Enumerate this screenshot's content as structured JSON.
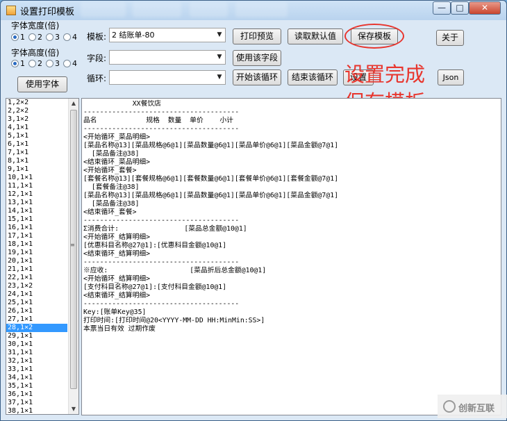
{
  "window": {
    "title": "设置打印模板",
    "controls": {
      "minimize": "—",
      "maximize": "□",
      "close": "✕"
    }
  },
  "left_panel": {
    "font_width_label": "字体宽度(倍)",
    "font_height_label": "字体高度(倍)",
    "width_options": [
      "1",
      "2",
      "3",
      "4"
    ],
    "width_selected": "1",
    "height_options": [
      "1",
      "2",
      "3",
      "4"
    ],
    "height_selected": "1",
    "use_font_button": "使用字体"
  },
  "fields": {
    "template_label": "模板:",
    "template_value": "2 结账单-80",
    "field_label": "字段:",
    "field_value": "",
    "loop_label": "循环:",
    "loop_value": ""
  },
  "buttons": {
    "print_preview": "打印预览",
    "read_default": "读取默认值",
    "save_template": "保存模板",
    "about": "关于",
    "use_field": "使用该字段",
    "start_loop": "开始该循环",
    "end_loop": "结束该循环",
    "set": "设置",
    "json": "Json"
  },
  "annotation": {
    "line1": "设置完成",
    "line2": "保存模板",
    "color": "#e8352d"
  },
  "list_items": [
    "1,2×2",
    "2,2×2",
    "3,1×2",
    "4,1×1",
    "5,1×1",
    "6,1×1",
    "7,1×1",
    "8,1×1",
    "9,1×1",
    "10,1×1",
    "11,1×1",
    "12,1×1",
    "13,1×1",
    "14,1×1",
    "15,1×1",
    "16,1×1",
    "17,1×1",
    "18,1×1",
    "19,1×1",
    "20,1×1",
    "21,1×1",
    "22,1×1",
    "23,1×2",
    "24,1×1",
    "25,1×1",
    "26,1×1",
    "27,1×1",
    "28,1×2",
    "29,1×1",
    "30,1×1",
    "31,1×1",
    "32,1×1",
    "33,1×1",
    "34,1×1",
    "35,1×1",
    "36,1×1",
    "37,1×1",
    "38,1×1"
  ],
  "list_selected_index": 27,
  "editor_lines": [
    "            XX餐饮店",
    "--------------------------------------",
    "品名            规格  数量  单价    小计",
    "--------------------------------------",
    "<开始循环_菜品明细>",
    "[菜品名称@13][菜品规格@6@1][菜品数量@6@1][菜品单价@6@1][菜品金额@7@1]",
    "  [菜品备注@38]",
    "<结束循环_菜品明细>",
    "<开始循环_套餐>",
    "[套餐名称@13][套餐规格@6@1][套餐数量@6@1][套餐单价@6@1][套餐金额@7@1]",
    "  [套餐备注@38]",
    "[菜品名称@13][菜品规格@6@1][菜品数量@6@1][菜品单价@6@1][菜品金额@7@1]",
    "  [菜品备注@38]",
    "<结束循环_套餐>",
    "--------------------------------------",
    "Σ消费合计:                [菜品总金额@10@1]",
    "<开始循环_结算明细>",
    "[优惠科目名称@27@1]:[优惠科目金额@10@1]",
    "<结束循环_结算明细>",
    "--------------------------------------",
    "※应收:                    [菜品折后总金额@10@1]",
    "<开始循环_结算明细>",
    "[支付科目名称@27@1]:[支付科目金额@10@1]",
    "<结束循环_结算明细>",
    "--------------------------------------",
    "Key:[账单Key@35]",
    "打印时间:[打印时间@20<YYYY-MM-DD HH:MinMin:SS>]",
    "本票当日有效 过期作废"
  ],
  "watermark": "创新互联"
}
